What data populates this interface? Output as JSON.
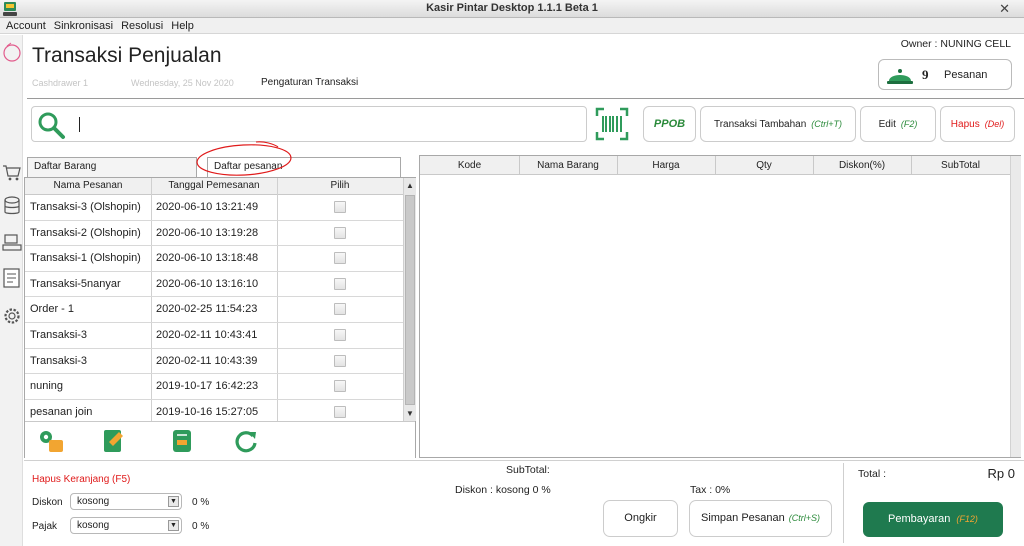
{
  "window": {
    "title": "Kasir Pintar Desktop 1.1.1  Beta 1",
    "close_glyph": "✕"
  },
  "menu": [
    "Account",
    "Sinkronisasi",
    "Resolusi",
    "Help"
  ],
  "header": {
    "title": "Transaksi Penjualan",
    "cashdrawer": "Cashdrawer 1",
    "date": "Wednesday, 25 Nov 2020",
    "settings_link": "Pengaturan Transaksi",
    "owner": "Owner : NUNING CELL",
    "orders_count": "9",
    "orders_label": "Pesanan"
  },
  "toolbar": {
    "search_placeholder": "",
    "ppob_label": "PPOB",
    "transaksi_tambahan": "Transaksi Tambahan",
    "transaksi_tambahan_shortcut": "(Ctrl+T)",
    "edit": "Edit",
    "edit_shortcut": "(F2)",
    "hapus": "Hapus",
    "hapus_shortcut": "(Del)"
  },
  "tabs": {
    "daftar_barang": "Daftar Barang",
    "daftar_pesanan": "Daftar pesanan"
  },
  "orders_table": {
    "columns": [
      "Nama Pesanan",
      "Tanggal Pemesanan",
      "Pilih"
    ],
    "rows": [
      {
        "name": "Transaksi-3 (Olshopin)",
        "date": "2020-06-10 13:21:49"
      },
      {
        "name": "Transaksi-2 (Olshopin)",
        "date": "2020-06-10 13:19:28"
      },
      {
        "name": "Transaksi-1 (Olshopin)",
        "date": "2020-06-10 13:18:48"
      },
      {
        "name": "Transaksi-5nanyar",
        "date": "2020-06-10 13:16:10"
      },
      {
        "name": "Order - 1",
        "date": "2020-02-25 11:54:23"
      },
      {
        "name": "Transaksi-3",
        "date": "2020-02-11 10:43:41"
      },
      {
        "name": "Transaksi-3",
        "date": "2020-02-11 10:43:39"
      },
      {
        "name": "nuning",
        "date": "2019-10-17 16:42:23"
      },
      {
        "name": "pesanan join",
        "date": "2019-10-16 15:27:05"
      }
    ]
  },
  "cart_table": {
    "columns": [
      "Kode",
      "Nama Barang",
      "Harga",
      "Qty",
      "Diskon(%)",
      "SubTotal"
    ]
  },
  "footer": {
    "hapus_keranjang": "Hapus Keranjang (F5)",
    "diskon_label": "Diskon",
    "diskon_value": "kosong",
    "diskon_pct": "0 %",
    "pajak_label": "Pajak",
    "pajak_value": "kosong",
    "pajak_pct": "0 %",
    "subtotal_label": "SubTotal:",
    "diskon_info": "Diskon : kosong 0 %",
    "tax_info": "Tax : 0%",
    "ongkir": "Ongkir",
    "simpan_pesanan": "Simpan Pesanan",
    "simpan_shortcut": "(Ctrl+S)",
    "total_label": "Total :",
    "total_value": "Rp 0",
    "pembayaran": "Pembayaran",
    "pembayaran_shortcut": "(F12)"
  },
  "colors": {
    "accent_green": "#1f7a4f",
    "danger_red": "#e01b1b",
    "shortcut_orange": "#f2a531"
  }
}
